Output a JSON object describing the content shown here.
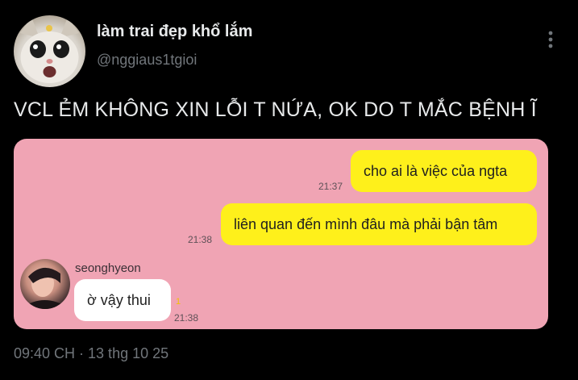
{
  "tweet": {
    "author": {
      "display_name": "làm trai đẹp khổ lắm",
      "handle": "@nggiaus1tgioi",
      "avatar_icon": "cat-avatar-icon"
    },
    "more_icon": "more-vertical-icon",
    "text": "VCL ẺM KHÔNG XIN LỖI T NỨA, OK DO T MẮC BỆNH Ĩ",
    "timestamp": "09:40 CH · 13 thg 10 25"
  },
  "chat": {
    "background_color": "#f0a4b4",
    "messages": [
      {
        "text": "cho ai là việc của ngta",
        "time": "21:37",
        "bubble_color": "#fef01b"
      },
      {
        "text": "liên quan đến mình đâu mà phải bận tâm",
        "time": "21:38",
        "bubble_color": "#fef01b"
      },
      {
        "sender": "seonghyeon",
        "text": "ờ vậy thui",
        "time": "21:38",
        "unread": "1",
        "bubble_color": "#ffffff"
      }
    ]
  }
}
